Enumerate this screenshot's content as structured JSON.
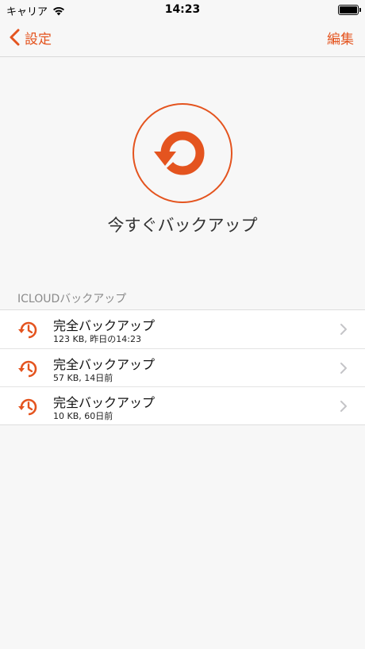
{
  "status_bar": {
    "carrier": "キャリア",
    "time": "14:23",
    "icons": [
      "wifi-icon",
      "battery-icon"
    ]
  },
  "nav": {
    "back_label": "設定",
    "edit_label": "編集",
    "back_icon": "chevron-left-icon"
  },
  "hero": {
    "icon": "backup-now-icon",
    "label": "今すぐバックアップ"
  },
  "section": {
    "header": "ICLOUDバックアップ",
    "items": [
      {
        "title": "完全バックアップ",
        "subtitle": "123 KB, 昨日の14:23",
        "icon": "history-icon"
      },
      {
        "title": "完全バックアップ",
        "subtitle": "57 KB, 14日前",
        "icon": "history-icon"
      },
      {
        "title": "完全バックアップ",
        "subtitle": "10 KB, 60日前",
        "icon": "history-icon"
      }
    ]
  },
  "colors": {
    "accent": "#e4541f",
    "background": "#f7f7f7",
    "list_background": "#ffffff",
    "secondary_text": "#8a8a8a"
  }
}
